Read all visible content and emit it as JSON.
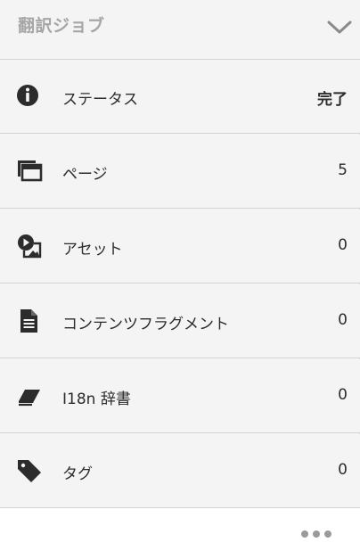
{
  "header": {
    "title": "翻訳ジョブ",
    "chevron_icon": "chevron-down-icon"
  },
  "rows": [
    {
      "icon": "info-icon",
      "label": "ステータス",
      "value": "完了"
    },
    {
      "icon": "pages-icon",
      "label": "ページ",
      "value": "5"
    },
    {
      "icon": "asset-icon",
      "label": "アセット",
      "value": "0"
    },
    {
      "icon": "document-icon",
      "label": "コンテンツフラグメント",
      "value": "0"
    },
    {
      "icon": "eraser-icon",
      "label": "I18n 辞書",
      "value": "0"
    },
    {
      "icon": "tag-icon",
      "label": "タグ",
      "value": "0"
    }
  ],
  "footer": {
    "more_icon": "more-icon"
  },
  "colors": {
    "title": "#a6a6a6",
    "text": "#2c2c2c",
    "background": "#f4f4f4",
    "divider": "#d3d3d3"
  }
}
